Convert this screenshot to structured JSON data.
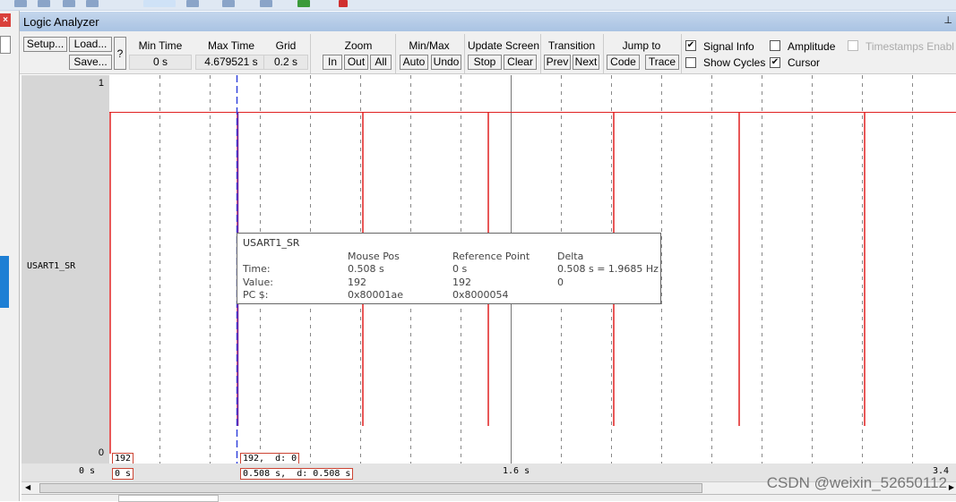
{
  "window": {
    "title": "Logic Analyzer",
    "close_icon": "close-icon"
  },
  "toolbar": {
    "setup": "Setup...",
    "load": "Load...",
    "save": "Save...",
    "help": "?",
    "min_time_label": "Min Time",
    "min_time": "0 s",
    "max_time_label": "Max Time",
    "max_time": "4.679521 s",
    "grid_label": "Grid",
    "grid": "0.2 s",
    "zoom_label": "Zoom",
    "zoom_in": "In",
    "zoom_out": "Out",
    "zoom_all": "All",
    "minmax_label": "Min/Max",
    "auto": "Auto",
    "undo": "Undo",
    "update_label": "Update Screen",
    "stop": "Stop",
    "clear": "Clear",
    "transition_label": "Transition",
    "prev": "Prev",
    "next": "Next",
    "jump_label": "Jump to",
    "code": "Code",
    "trace": "Trace",
    "signal_info": {
      "label": "Signal Info",
      "checked": true
    },
    "show_cycles": {
      "label": "Show Cycles",
      "checked": false
    },
    "amplitude": {
      "label": "Amplitude",
      "checked": false
    },
    "cursor": {
      "label": "Cursor",
      "checked": true
    },
    "timestamps": {
      "label": "Timestamps Enabl",
      "checked": false,
      "disabled": true
    }
  },
  "signal": {
    "name": "USART1_SR",
    "max": "1",
    "min": "0",
    "color": "#e02020"
  },
  "cursor": {
    "time_s": 0.508,
    "color": "#3344dd"
  },
  "grid_step_s": 0.2,
  "pulse_times_s": [
    0,
    0.508,
    1.008,
    1.508,
    2.008,
    2.508,
    3.008
  ],
  "markers": {
    "ref_value": "192",
    "ref_time": "0 s",
    "cursor_value": "192,  d: 0",
    "cursor_time": "0.508 s,  d: 0.508 s"
  },
  "axis": {
    "start": "0 s",
    "mid": "1.6 s",
    "end": "3.4"
  },
  "tooltip": {
    "name": "USART1_SR",
    "col_mouse": "Mouse Pos",
    "col_ref": "Reference Point",
    "col_delta": "Delta",
    "time_label": "Time:",
    "value_label": "Value:",
    "pc_label": "PC $:",
    "mouse_time": "0.508 s",
    "ref_time": "0 s",
    "delta_time": "0.508 s = 1.9685 Hz",
    "mouse_value": "192",
    "ref_value": "192",
    "delta_value": "0",
    "mouse_pc": "0x80001ae",
    "ref_pc": "0x8000054"
  },
  "watermark": "CSDN @weixin_52650112"
}
